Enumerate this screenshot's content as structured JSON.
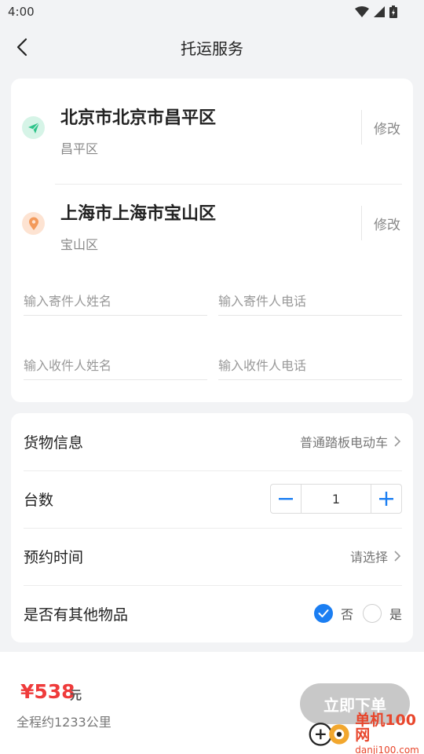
{
  "status_bar": {
    "time": "4:00"
  },
  "header": {
    "title": "托运服务"
  },
  "addresses": {
    "from": {
      "title": "北京市北京市昌平区",
      "subtitle": "昌平区",
      "edit_label": "修改"
    },
    "to": {
      "title": "上海市上海市宝山区",
      "subtitle": "宝山区",
      "edit_label": "修改"
    }
  },
  "contact_fields": {
    "sender_name_placeholder": "输入寄件人姓名",
    "sender_phone_placeholder": "输入寄件人电话",
    "receiver_name_placeholder": "输入收件人姓名",
    "receiver_phone_placeholder": "输入收件人电话"
  },
  "info": {
    "cargo": {
      "label": "货物信息",
      "value": "普通踏板电动车"
    },
    "quantity": {
      "label": "台数",
      "value": "1"
    },
    "appointment": {
      "label": "预约时间",
      "value": "请选择"
    },
    "other_items": {
      "label": "是否有其他物品",
      "options": [
        "否",
        "是"
      ],
      "selected": "否"
    }
  },
  "footer": {
    "price": "¥538",
    "price_unit": "元",
    "distance": "全程约1233公里",
    "order_button": "立即下单"
  },
  "watermark": {
    "cn": "单机100网",
    "en": "danji100.com"
  },
  "colors": {
    "accent_blue": "#1b7ef2",
    "price_red": "#ef3b3b",
    "origin_green": "#2ec48a",
    "destination_orange": "#f39a5b",
    "disabled_button": "#c8c8c8"
  },
  "icons": {
    "back": "chevron-left-icon",
    "origin": "paper-plane-icon",
    "destination": "location-pin-icon",
    "chevron": "chevron-right-icon"
  }
}
